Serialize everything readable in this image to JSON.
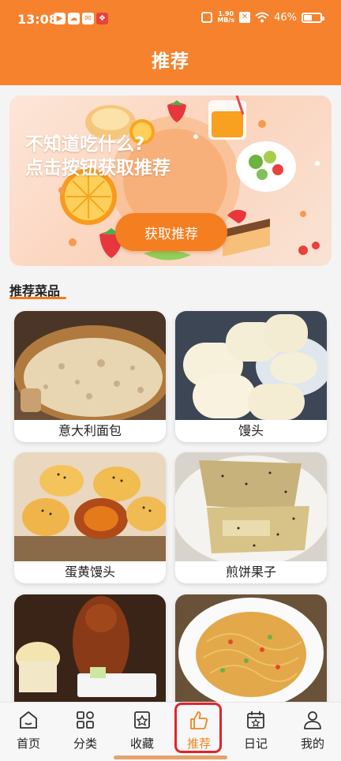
{
  "status_bar": {
    "time": "13:08",
    "notif_icons": [
      "media-app-icon",
      "cloud-app-icon",
      "mail-app-icon",
      "shop-app-icon"
    ],
    "network_speed": "1.90\nMB/s",
    "battery": "46%"
  },
  "header": {
    "title": "推荐"
  },
  "banner": {
    "line1": "不知道吃什么?",
    "line2": "点击按钮获取推荐",
    "button_label": "获取推荐"
  },
  "section": {
    "title": "推荐菜品"
  },
  "dishes": [
    {
      "name": "意大利面包",
      "image": "bread-photo"
    },
    {
      "name": "馒头",
      "image": "steamed-bun-photo"
    },
    {
      "name": "蛋黄馒头",
      "image": "egg-yolk-pastry-photo"
    },
    {
      "name": "煎饼果子",
      "image": "jianbing-photo"
    },
    {
      "name": "",
      "image": "roast-duck-photo"
    },
    {
      "name": "",
      "image": "stir-fried-noodles-photo"
    }
  ],
  "bottom_nav": {
    "items": [
      {
        "label": "首页",
        "icon": "home-icon"
      },
      {
        "label": "分类",
        "icon": "category-icon"
      },
      {
        "label": "收藏",
        "icon": "favorites-icon"
      },
      {
        "label": "推荐",
        "icon": "thumbs-up-icon"
      },
      {
        "label": "日记",
        "icon": "calendar-icon"
      },
      {
        "label": "我的",
        "icon": "person-icon"
      }
    ],
    "active_index": 3
  },
  "colors": {
    "brand": "#f6822e",
    "active_tab": "#f0841f",
    "highlight_box": "#e4232a"
  }
}
